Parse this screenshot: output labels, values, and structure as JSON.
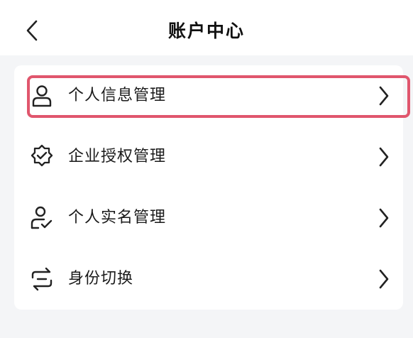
{
  "header": {
    "back_icon": "chevron-left-icon",
    "title": "账户中心"
  },
  "menu": {
    "items": [
      {
        "label": "个人信息管理",
        "icon": "user-icon",
        "chevron": "chevron-right-icon",
        "highlighted": true
      },
      {
        "label": "企业授权管理",
        "icon": "badge-check-icon",
        "chevron": "chevron-right-icon",
        "highlighted": false
      },
      {
        "label": "个人实名管理",
        "icon": "user-verified-icon",
        "chevron": "chevron-right-icon",
        "highlighted": false
      },
      {
        "label": "身份切换",
        "icon": "switch-icon",
        "chevron": "chevron-right-icon",
        "highlighted": false
      }
    ]
  },
  "colors": {
    "background": "#f4f5f7",
    "card": "#ffffff",
    "text": "#111111",
    "highlight": "#e0566d"
  }
}
